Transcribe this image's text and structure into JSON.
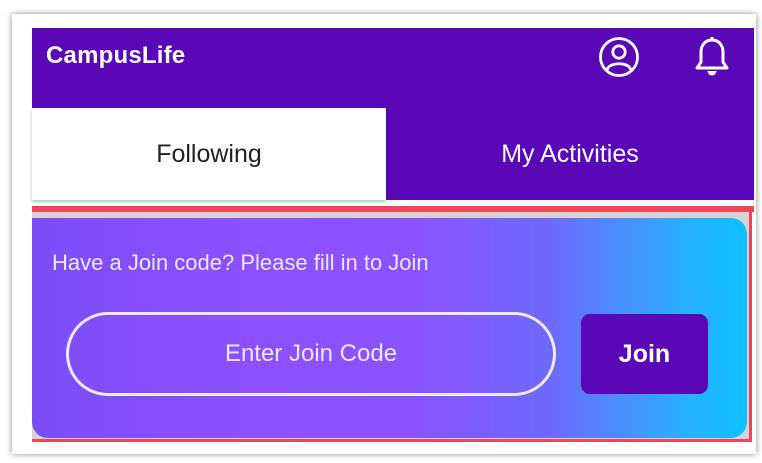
{
  "app": {
    "title": "CampusLife",
    "icons": {
      "profile": "user-circle-icon",
      "notifications": "bell-icon"
    }
  },
  "tabs": [
    {
      "label": "Following",
      "active": true
    },
    {
      "label": "My Activities",
      "active": false
    }
  ],
  "join": {
    "prompt": "Have a Join code? Please fill in to Join",
    "input_placeholder": "Enter Join Code",
    "input_value": "",
    "button_label": "Join"
  },
  "colors": {
    "brand_purple": "#5a07b8",
    "highlight_red": "#ee4455",
    "card_gradient_start": "#7b4df6",
    "card_gradient_end": "#10bfff"
  }
}
